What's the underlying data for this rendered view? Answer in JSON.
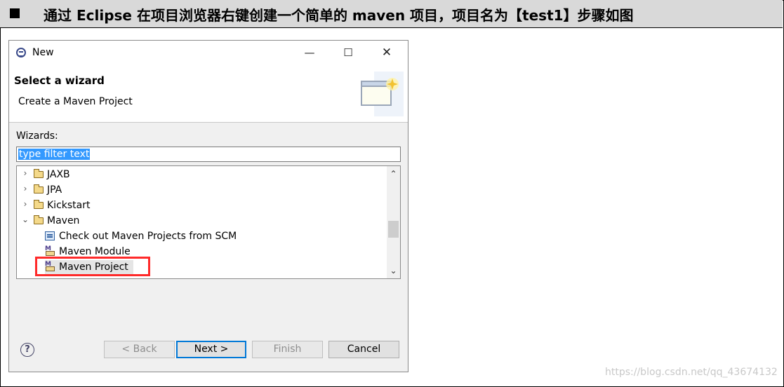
{
  "header": {
    "title": "通过 Eclipse 在项目浏览器右键创建一个简单的 maven 项目，项目名为【test1】步骤如图"
  },
  "window": {
    "title": "New",
    "minimize_glyph": "—",
    "maximize_glyph": "☐",
    "close_glyph": "✕"
  },
  "banner": {
    "title": "Select a wizard",
    "description": "Create a Maven Project"
  },
  "wizards": {
    "label": "Wizards:",
    "filter_text": "type filter text"
  },
  "tree": {
    "folders": [
      {
        "label": "JAXB",
        "arrow": "›"
      },
      {
        "label": "JPA",
        "arrow": "›"
      },
      {
        "label": "Kickstart",
        "arrow": "›"
      },
      {
        "label": "Maven",
        "arrow": "⌄"
      }
    ],
    "maven_children": [
      {
        "label": "Check out Maven Projects from SCM",
        "icon": "scm-icon"
      },
      {
        "label": "Maven Module",
        "icon": "maven-icon"
      },
      {
        "label": "Maven Project",
        "icon": "maven-icon",
        "selected": true
      }
    ]
  },
  "scrollbar": {
    "up": "⌃",
    "down": "⌄"
  },
  "buttons": {
    "help": "?",
    "back": "< Back",
    "next": "Next >",
    "finish": "Finish",
    "cancel": "Cancel"
  },
  "watermark": "https://blog.csdn.net/qq_43674132",
  "colors": {
    "highlight": "#ff2a2a",
    "filter_selection": "#3399ff",
    "default_button": "#0078d7"
  }
}
